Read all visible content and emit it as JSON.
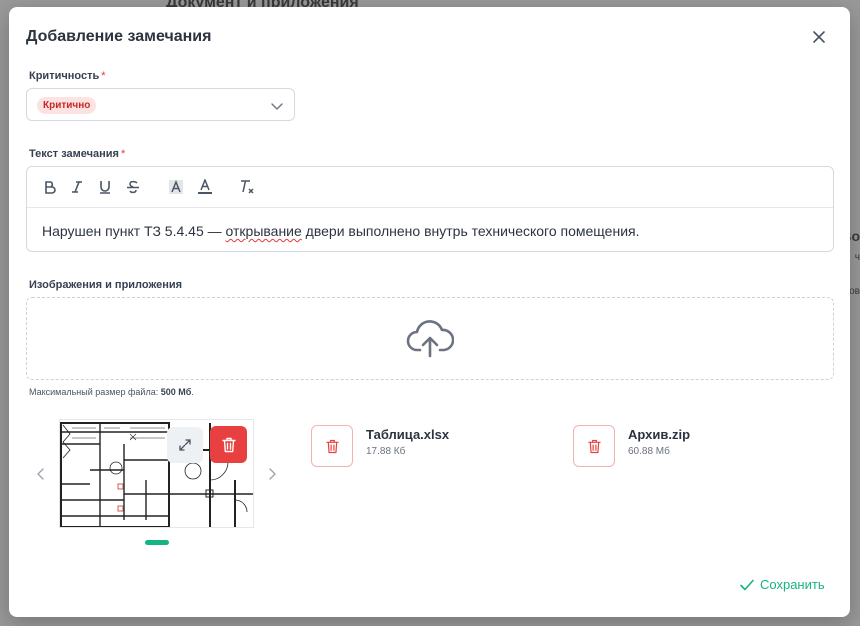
{
  "background": {
    "title": "Документ и приложения",
    "right_heading": "Bo",
    "right_sub": "ч",
    "right_sub2": "ов"
  },
  "modal": {
    "title": "Добавление замечания",
    "close_icon": "close-icon"
  },
  "criticality": {
    "label": "Критичность",
    "required_mark": "*",
    "selected": "Критично",
    "badge_color": "#fde2e2",
    "badge_text_color": "#c62828"
  },
  "remark": {
    "label": "Текст замечания",
    "required_mark": "*",
    "toolbar": [
      "bold",
      "italic",
      "underline",
      "strikethrough",
      "highlight",
      "text-color",
      "clear-format"
    ],
    "text_before": "Нарушен пункт ТЗ 5.4.45 — ",
    "text_misspelled": "открывание",
    "text_after": " двери выполнено внутрь технического помещения."
  },
  "attachments": {
    "label": "Изображения и приложения",
    "hint_prefix": "Максимальный размер файла: ",
    "hint_size": "500 Мб",
    "hint_suffix": ".",
    "files": [
      {
        "name": "Таблица.xlsx",
        "size": "17.88 Кб"
      },
      {
        "name": "Архив.zip",
        "size": "60.88 Мб"
      }
    ]
  },
  "footer": {
    "save_label": "Сохранить",
    "accent": "#16b383"
  }
}
